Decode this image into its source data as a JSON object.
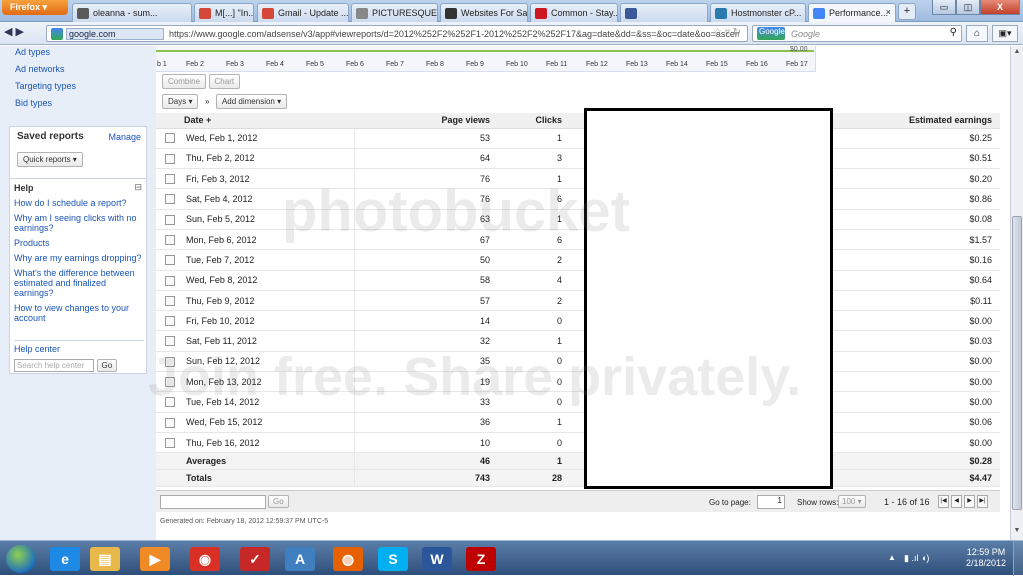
{
  "browser": {
    "menu_button": "Firefox ▾",
    "tabs": [
      {
        "label": "oleanna - sum...",
        "icon": "user-icon",
        "color": "#5a5a5a"
      },
      {
        "label": "M[...] \"In...",
        "icon": "gmail-icon",
        "color": "#d44638"
      },
      {
        "label": "Gmail - Update ...",
        "icon": "gmail-icon",
        "color": "#d44638"
      },
      {
        "label": "PICTURESQUE_...",
        "icon": "page-icon",
        "color": "#888888"
      },
      {
        "label": "Websites For Sal...",
        "icon": "flippa-icon",
        "color": "#333333"
      },
      {
        "label": "Common - Stay...",
        "icon": "youtube-icon",
        "color": "#cc181e"
      },
      {
        "label": "",
        "icon": "facebook-icon",
        "color": "#3b5998"
      },
      {
        "label": "Hostmonster cP...",
        "icon": "hostmonster-icon",
        "color": "#2a7ab0"
      },
      {
        "label": "Performance...",
        "icon": "adsense-icon",
        "color": "#4285f4"
      }
    ],
    "new_tab": "+",
    "window_controls": {
      "minimize": "▭",
      "maximize": "◫",
      "close": "X"
    },
    "address": {
      "domain": "google.com",
      "url": "https://www.google.com/adsense/v3/app#viewreports/d=2012%252F2%252F1-2012%252F2%252F17&ag=date&dd=&ss=&oc=date&oo=ascenc"
    },
    "search": {
      "engine": "Google",
      "placeholder": "Google"
    }
  },
  "sidebar": {
    "links": [
      "Ad types",
      "Ad networks",
      "Targeting types",
      "Bid types"
    ],
    "saved_reports": {
      "title": "Saved reports",
      "manage": "Manage",
      "quick_reports": "Quick reports ▾"
    },
    "help": {
      "title": "Help",
      "links": [
        "How do I schedule a report?",
        "Why am I seeing clicks with no earnings?",
        "Products",
        "Why are my earnings dropping?",
        "What's the difference between estimated and finalized earnings?",
        "How to view changes to your account"
      ],
      "help_center": "Help center",
      "search_placeholder": "Search help center",
      "go": "Go"
    }
  },
  "chart": {
    "y_max_label": "$0.00",
    "x_ticks": [
      "b 1",
      "Feb 2",
      "Feb 3",
      "Feb 4",
      "Feb 5",
      "Feb 6",
      "Feb 7",
      "Feb 8",
      "Feb 9",
      "Feb 10",
      "Feb 11",
      "Feb 12",
      "Feb 13",
      "Feb 14",
      "Feb 15",
      "Feb 16",
      "Feb 17"
    ]
  },
  "toolbar": {
    "combine": "Combine",
    "chart": "Chart",
    "days": "Days ▾",
    "separator": "»",
    "add_dimension": "Add dimension ▾"
  },
  "table": {
    "headers": {
      "date": "Date +",
      "page_views": "Page views",
      "clicks": "Clicks",
      "earnings": "Estimated earnings"
    },
    "rows": [
      {
        "date": "Wed, Feb 1, 2012",
        "views": "53",
        "clicks": "1",
        "earnings": "$0.25"
      },
      {
        "date": "Thu, Feb 2, 2012",
        "views": "64",
        "clicks": "3",
        "earnings": "$0.51"
      },
      {
        "date": "Fri, Feb 3, 2012",
        "views": "76",
        "clicks": "1",
        "earnings": "$0.20"
      },
      {
        "date": "Sat, Feb 4, 2012",
        "views": "76",
        "clicks": "6",
        "earnings": "$0.86"
      },
      {
        "date": "Sun, Feb 5, 2012",
        "views": "63",
        "clicks": "1",
        "earnings": "$0.08"
      },
      {
        "date": "Mon, Feb 6, 2012",
        "views": "67",
        "clicks": "6",
        "earnings": "$1.57"
      },
      {
        "date": "Tue, Feb 7, 2012",
        "views": "50",
        "clicks": "2",
        "earnings": "$0.16"
      },
      {
        "date": "Wed, Feb 8, 2012",
        "views": "58",
        "clicks": "4",
        "earnings": "$0.64"
      },
      {
        "date": "Thu, Feb 9, 2012",
        "views": "57",
        "clicks": "2",
        "earnings": "$0.11"
      },
      {
        "date": "Fri, Feb 10, 2012",
        "views": "14",
        "clicks": "0",
        "earnings": "$0.00"
      },
      {
        "date": "Sat, Feb 11, 2012",
        "views": "32",
        "clicks": "1",
        "earnings": "$0.03"
      },
      {
        "date": "Sun, Feb 12, 2012",
        "views": "35",
        "clicks": "0",
        "earnings": "$0.00"
      },
      {
        "date": "Mon, Feb 13, 2012",
        "views": "19",
        "clicks": "0",
        "earnings": "$0.00"
      },
      {
        "date": "Tue, Feb 14, 2012",
        "views": "33",
        "clicks": "0",
        "earnings": "$0.00"
      },
      {
        "date": "Wed, Feb 15, 2012",
        "views": "36",
        "clicks": "1",
        "earnings": "$0.06"
      },
      {
        "date": "Thu, Feb 16, 2012",
        "views": "10",
        "clicks": "0",
        "earnings": "$0.00"
      }
    ],
    "averages": {
      "label": "Averages",
      "views": "46",
      "clicks": "1",
      "earnings": "$0.28"
    },
    "totals": {
      "label": "Totals",
      "views": "743",
      "clicks": "28",
      "earnings": "$4.47"
    }
  },
  "footer": {
    "go": "Go",
    "go_to_page_label": "Go to page:",
    "page_value": "1",
    "show_rows_label": "Show rows:",
    "rows_value": "100 ▾",
    "range": "1 - 16 of 16",
    "generated": "Generated on: February 18, 2012 12:59:37 PM UTC-5"
  },
  "watermark": {
    "line1": "photobucket",
    "line2": "Join free. Share privately."
  },
  "taskbar": {
    "apps": [
      {
        "icon": "ie-icon",
        "glyph": "e",
        "color": "#1e88e5"
      },
      {
        "icon": "explorer-icon",
        "glyph": "▤",
        "color": "#e8b84a"
      },
      {
        "icon": "media-player-icon",
        "glyph": "▶",
        "color": "#f08a24"
      },
      {
        "icon": "chrome-icon",
        "glyph": "◉",
        "color": "#d93025"
      },
      {
        "icon": "app-icon",
        "glyph": "✓",
        "color": "#c62828"
      },
      {
        "icon": "paint-icon",
        "glyph": "A",
        "color": "#3f7fbf"
      },
      {
        "icon": "firefox-icon",
        "glyph": "◍",
        "color": "#e66000"
      },
      {
        "icon": "skype-icon",
        "glyph": "S",
        "color": "#00aff0"
      },
      {
        "icon": "word-icon",
        "glyph": "W",
        "color": "#2b579a"
      },
      {
        "icon": "filezilla-icon",
        "glyph": "Z",
        "color": "#bf0000"
      }
    ],
    "time": "12:59 PM",
    "date": "2/18/2012"
  }
}
